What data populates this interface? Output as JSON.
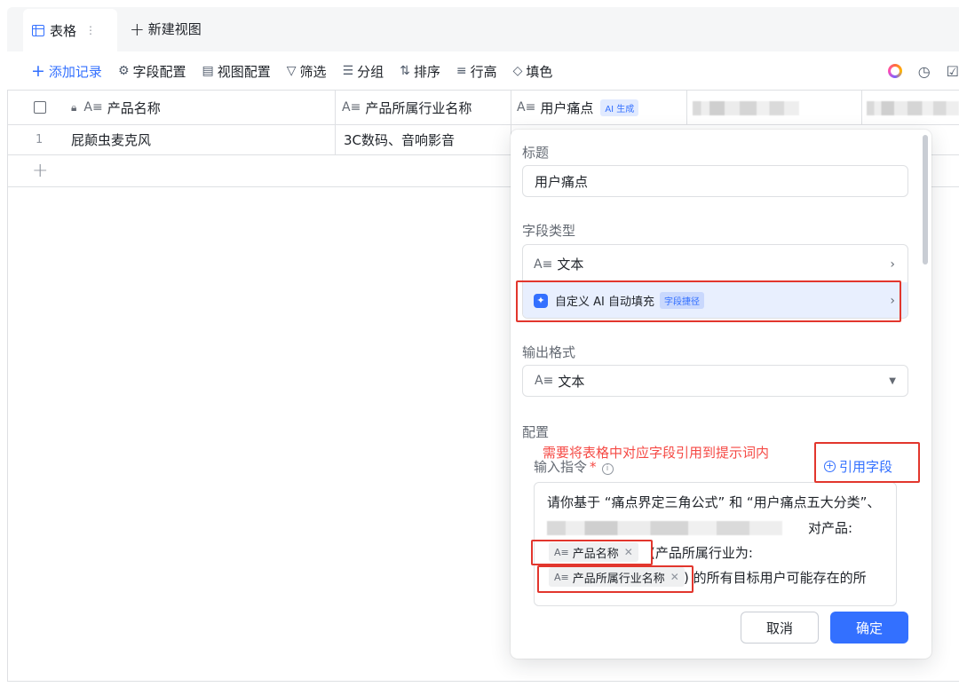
{
  "tabs": {
    "active_label": "表格",
    "new_view_label": "新建视图"
  },
  "toolbar": {
    "add_record": "添加记录",
    "field_config": "字段配置",
    "view_config": "视图配置",
    "filter": "筛选",
    "group": "分组",
    "sort": "排序",
    "row_height": "行高",
    "fill_color": "填色"
  },
  "grid": {
    "columns": [
      {
        "label": "产品名称",
        "type_icon": "text-field-icon",
        "locked": true
      },
      {
        "label": "产品所属行业名称",
        "type_icon": "text-field-icon"
      },
      {
        "label": "用户痛点",
        "type_icon": "text-field-icon",
        "tag": "AI 生成"
      }
    ],
    "rows": [
      {
        "index": "1",
        "product_name": "屁颠虫麦克风",
        "industry": "3C数码、音响影音"
      }
    ]
  },
  "panel": {
    "title_label": "标题",
    "title_value": "用户痛点",
    "field_type_label": "字段类型",
    "field_type_text": "文本",
    "field_type_ai": "自定义 AI 自动填充",
    "field_type_ai_tag": "字段捷径",
    "output_format_label": "输出格式",
    "output_format_value": "文本",
    "config_label": "配置",
    "annotation": "需要将表格中对应字段引用到提示词内",
    "instruction_label": "输入指令",
    "instruction_required": "*",
    "reference_field": "引用字段",
    "prompt": {
      "line1": "请你基于 “痛点界定三角公式” 和 “用户痛点五大分类”、",
      "line2_suffix": "对产品:",
      "chip_product": "产品名称",
      "line3_text": "(产品所属行业为:",
      "chip_industry": "产品所属行业名称",
      "line4_text": ") 的所有目标用户可能存在的所"
    },
    "cancel": "取消",
    "confirm": "确定"
  },
  "colors": {
    "accent": "#3370ff",
    "annotation_red": "#e2362d"
  }
}
